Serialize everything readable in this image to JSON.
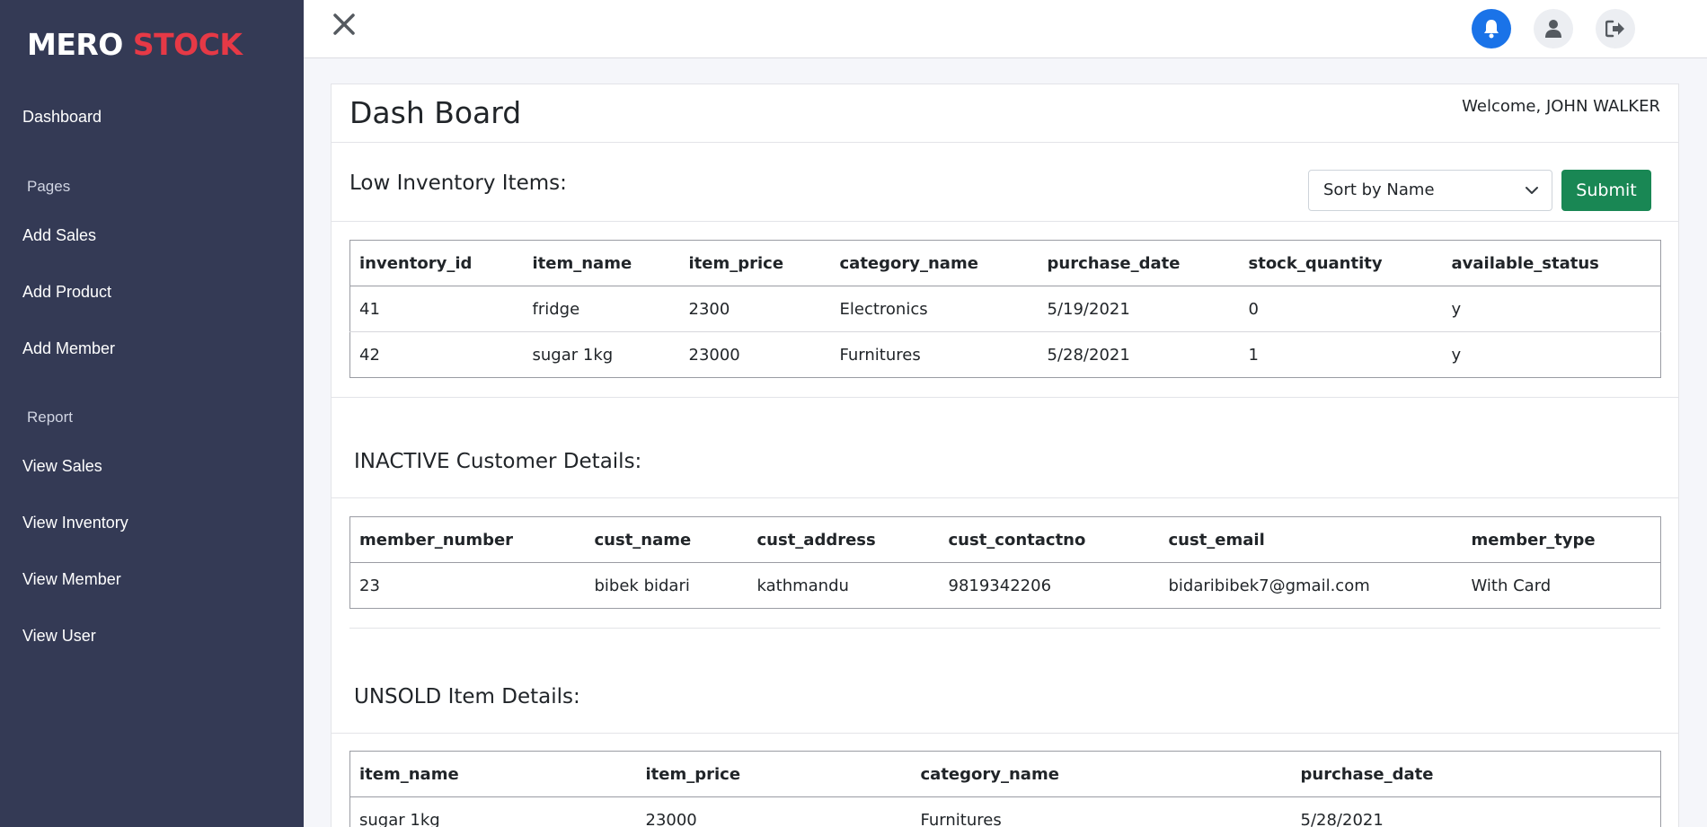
{
  "brand": {
    "part1": "MERO",
    "part2": "STOCK"
  },
  "sidebar": {
    "dashboard": "Dashboard",
    "pages_heading": "Pages",
    "add_sales": "Add Sales",
    "add_product": "Add Product",
    "add_member": "Add Member",
    "report_heading": "Report",
    "view_sales": "View Sales",
    "view_inventory": "View Inventory",
    "view_member": "View Member",
    "view_user": "View User"
  },
  "header": {
    "icons": [
      "close-icon",
      "bell-icon",
      "user-icon",
      "logout-icon"
    ],
    "colors": {
      "bell_bg": "#1a73e8",
      "sidebar_bg": "#343a55",
      "brand_accent": "#e63946",
      "submit_bg": "#198754"
    }
  },
  "page": {
    "title": "Dash Board",
    "welcome": "Welcome, JOHN WALKER"
  },
  "low_inventory": {
    "title": "Low Inventory Items:",
    "sort_selected": "Sort by Name",
    "submit_label": "Submit",
    "columns": [
      "inventory_id",
      "item_name",
      "item_price",
      "category_name",
      "purchase_date",
      "stock_quantity",
      "available_status"
    ],
    "rows": [
      [
        "41",
        "fridge",
        "2300",
        "Electronics",
        "5/19/2021",
        "0",
        "y"
      ],
      [
        "42",
        "sugar 1kg",
        "23000",
        "Furnitures",
        "5/28/2021",
        "1",
        "y"
      ]
    ]
  },
  "inactive_customers": {
    "title": "INACTIVE Customer Details:",
    "columns": [
      "member_number",
      "cust_name",
      "cust_address",
      "cust_contactno",
      "cust_email",
      "member_type"
    ],
    "rows": [
      [
        "23",
        "bibek bidari",
        "kathmandu",
        "9819342206",
        "bidaribibek7@gmail.com",
        "With Card"
      ]
    ]
  },
  "unsold_items": {
    "title": "UNSOLD Item Details:",
    "columns": [
      "item_name",
      "item_price",
      "category_name",
      "purchase_date"
    ],
    "rows": [
      [
        "sugar 1kg",
        "23000",
        "Furnitures",
        "5/28/2021"
      ]
    ]
  }
}
